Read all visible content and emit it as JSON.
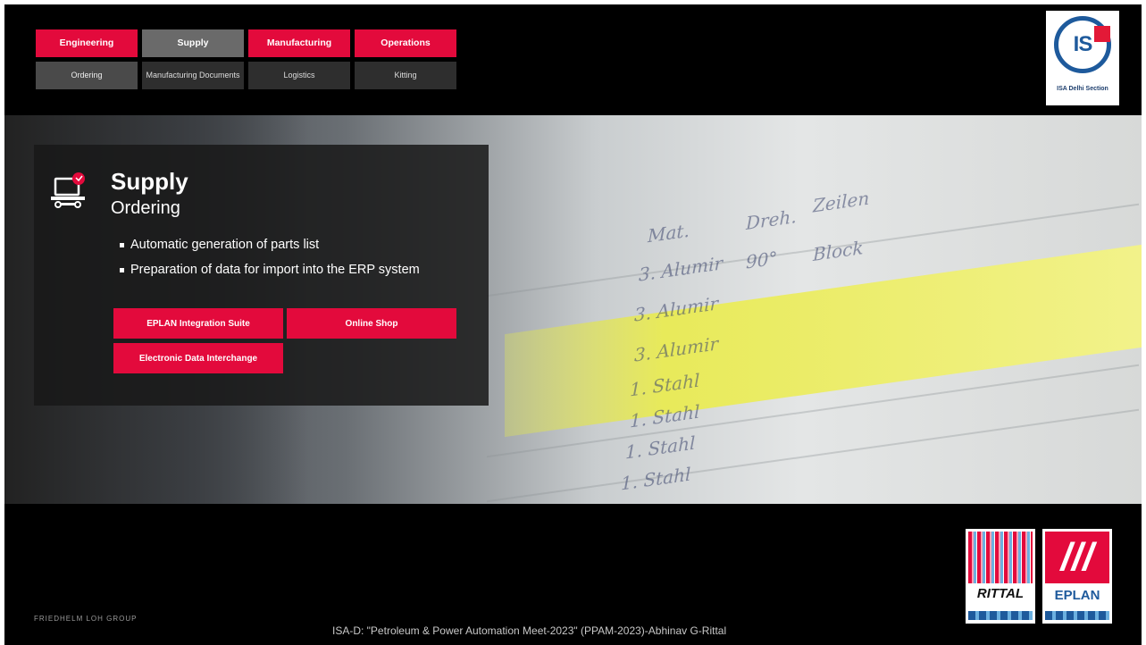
{
  "nav": {
    "top": [
      {
        "label": "Engineering",
        "style": "red"
      },
      {
        "label": "Supply",
        "style": "gray"
      },
      {
        "label": "Manufacturing",
        "style": "red"
      },
      {
        "label": "Operations",
        "style": "red"
      }
    ],
    "bottom": [
      {
        "label": "Ordering",
        "style": "dark-active"
      },
      {
        "label": "Manufacturing Documents",
        "style": "dark"
      },
      {
        "label": "Logistics",
        "style": "dark"
      },
      {
        "label": "Kitting",
        "style": "dark"
      }
    ]
  },
  "isa_logo": {
    "text": "IS",
    "caption": "ISA Delhi Section"
  },
  "panel": {
    "title": "Supply",
    "subtitle": "Ordering",
    "bullets": [
      "Automatic generation of parts list",
      "Preparation of data for import into the ERP system"
    ],
    "buttons": [
      "EPLAN Integration Suite",
      "Online Shop",
      "Electronic Data Interchange"
    ]
  },
  "hero_cells": {
    "header": [
      "Mat.",
      "Dreh.",
      "Zeilen"
    ],
    "rows": [
      "3. Alumir",
      "3. Alumir",
      "3. Alumir",
      "1. Stahl",
      "1. Stahl",
      "1. Stahl",
      "1. Stahl"
    ],
    "angle": "90°",
    "fill": "Block"
  },
  "brands": {
    "rittal": "RITTAL",
    "eplan": "EPLAN"
  },
  "footer": {
    "left": "FRIEDHELM LOH GROUP",
    "center": "ISA-D: \"Petroleum & Power Automation Meet-2023\" (PPAM-2023)-Abhinav G-Rittal"
  },
  "colors": {
    "accent": "#e30a3c",
    "nav_gray": "#6a6a6a",
    "isa_blue": "#1e5a9c"
  }
}
